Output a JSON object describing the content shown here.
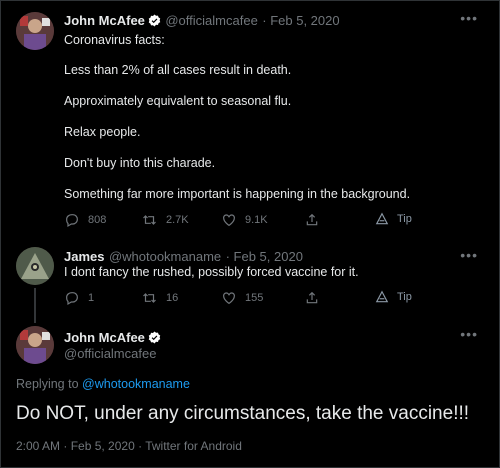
{
  "colors": {
    "background": "#000000",
    "text": "#e7e9ea",
    "muted": "#71767b",
    "accent": "#1d9bf0",
    "verified": "#ffffff"
  },
  "tweet1": {
    "name": "John McAfee",
    "handle": "@officialmcafee",
    "date": "· Feb 5, 2020",
    "lines": [
      "Coronavirus facts:",
      "Less than 2% of all cases result in death.",
      "Approximately equivalent to seasonal flu.",
      "Relax people.",
      "Don't buy into this charade.",
      "Something far more important is happening in the background."
    ],
    "actions": {
      "replies": "808",
      "retweets": "2.7K",
      "likes": "9.1K",
      "tip": "Tip"
    }
  },
  "tweet2": {
    "name": "James",
    "handle": "@whotookmaname",
    "date": "· Feb 5, 2020",
    "text": "I dont fancy the rushed, possibly forced vaccine for it.",
    "actions": {
      "replies": "1",
      "retweets": "16",
      "likes": "155",
      "tip": "Tip"
    }
  },
  "tweet3": {
    "name": "John McAfee",
    "handle": "@officialmcafee",
    "replying_prefix": "Replying to",
    "replying_handle": "@whotookmaname",
    "text": "Do NOT, under any circumstances, take the vaccine!!!",
    "meta": "2:00 AM · Feb 5, 2020 · Twitter for Android"
  },
  "icons": [
    "more-icon",
    "verified-icon",
    "reply-icon",
    "retweet-icon",
    "like-icon",
    "share-icon",
    "tip-icon"
  ]
}
